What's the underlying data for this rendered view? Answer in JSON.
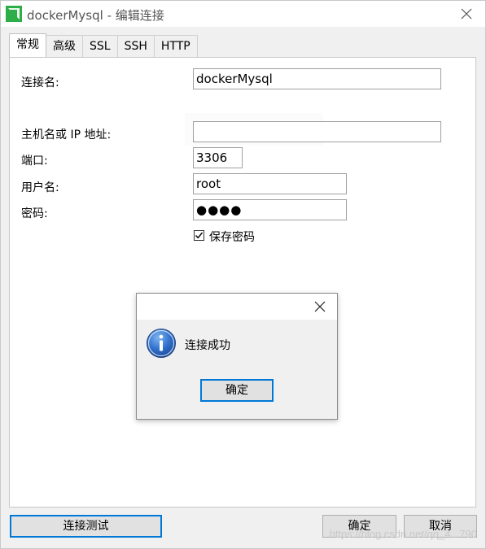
{
  "window": {
    "title": "dockerMysql - 编辑连接",
    "brand_color": "#2eae49"
  },
  "tabs": [
    {
      "label": "常规",
      "active": true
    },
    {
      "label": "高级",
      "active": false
    },
    {
      "label": "SSL",
      "active": false
    },
    {
      "label": "SSH",
      "active": false
    },
    {
      "label": "HTTP",
      "active": false
    }
  ],
  "form": {
    "connection_name": {
      "label": "连接名:",
      "value": "dockerMysql"
    },
    "host": {
      "label": "主机名或 IP 地址:",
      "value": ""
    },
    "port": {
      "label": "端口:",
      "value": "3306"
    },
    "username": {
      "label": "用户名:",
      "value": "root"
    },
    "password": {
      "label": "密码:",
      "value": "●●●●"
    },
    "save_password": {
      "label": "保存密码",
      "checked": true
    }
  },
  "footer": {
    "test_button": "连接测试",
    "ok_button": "确定",
    "cancel_button": "取消"
  },
  "watermark": "https://blog.csdn.net/qq_4...790",
  "dialog": {
    "message": "连接成功",
    "ok_button": "确定",
    "icon": "info-icon"
  }
}
